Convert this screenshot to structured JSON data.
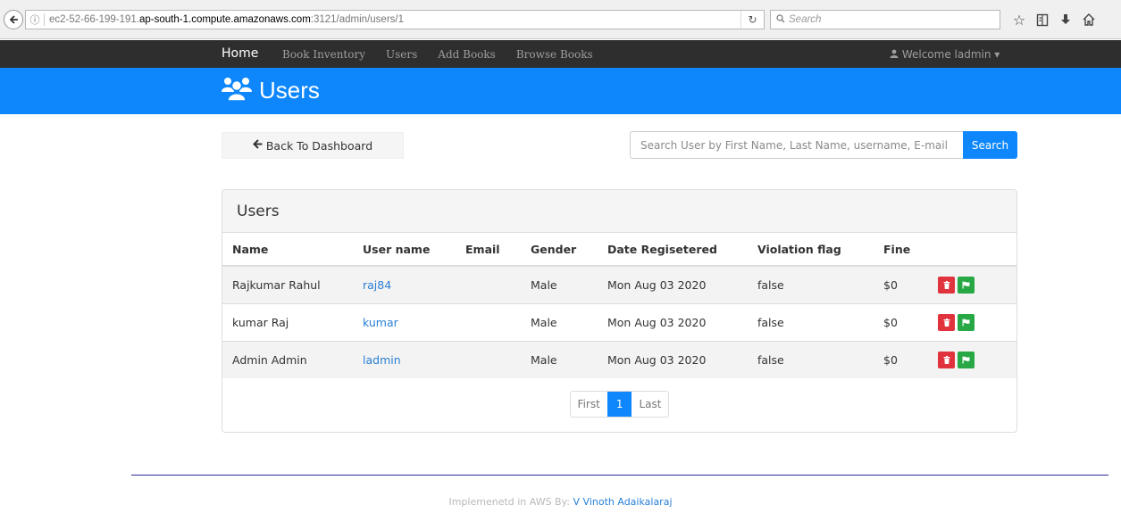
{
  "browser": {
    "url_prefix": "ec2-52-66-199-191.",
    "url_domain": "ap-south-1.compute.amazonaws.com",
    "url_suffix": ":3121/admin/users/1",
    "search_placeholder": "Search",
    "icons": [
      "back-icon",
      "info-icon",
      "reload-icon",
      "search-icon",
      "star-icon",
      "reading-list-icon",
      "download-icon",
      "home-icon"
    ]
  },
  "navbar": {
    "brand": "Home",
    "links": [
      "Book Inventory",
      "Users",
      "Add Books",
      "Browse Books"
    ],
    "welcome": "Welcome ladmin"
  },
  "header": {
    "title": "Users",
    "icon": "users-icon"
  },
  "toolbar": {
    "back_label": "Back To Dashboard",
    "search_placeholder": "Search User by First Name, Last Name, username, E-mail",
    "search_button": "Search"
  },
  "panel": {
    "heading": "Users",
    "columns": [
      "Name",
      "User name",
      "Email",
      "Gender",
      "Date Regisetered",
      "Violation flag",
      "Fine"
    ],
    "rows": [
      {
        "name": "Rajkumar Rahul",
        "username": "raj84",
        "email": "",
        "gender": "Male",
        "date": "Mon Aug 03 2020",
        "violation": "false",
        "fine": "$0"
      },
      {
        "name": "kumar Raj",
        "username": "kumar",
        "email": "",
        "gender": "Male",
        "date": "Mon Aug 03 2020",
        "violation": "false",
        "fine": "$0"
      },
      {
        "name": "Admin Admin",
        "username": "ladmin",
        "email": "",
        "gender": "Male",
        "date": "Mon Aug 03 2020",
        "violation": "false",
        "fine": "$0"
      }
    ],
    "pagination": {
      "first": "First",
      "current": "1",
      "last": "Last"
    }
  },
  "footer": {
    "text": "Implemenetd in AWS By:",
    "author": "V Vinoth Adaikalaraj"
  },
  "colors": {
    "primary": "#0d87fb",
    "navbar": "#2e2e2e",
    "delete": "#e0333d",
    "flag": "#27a845"
  }
}
